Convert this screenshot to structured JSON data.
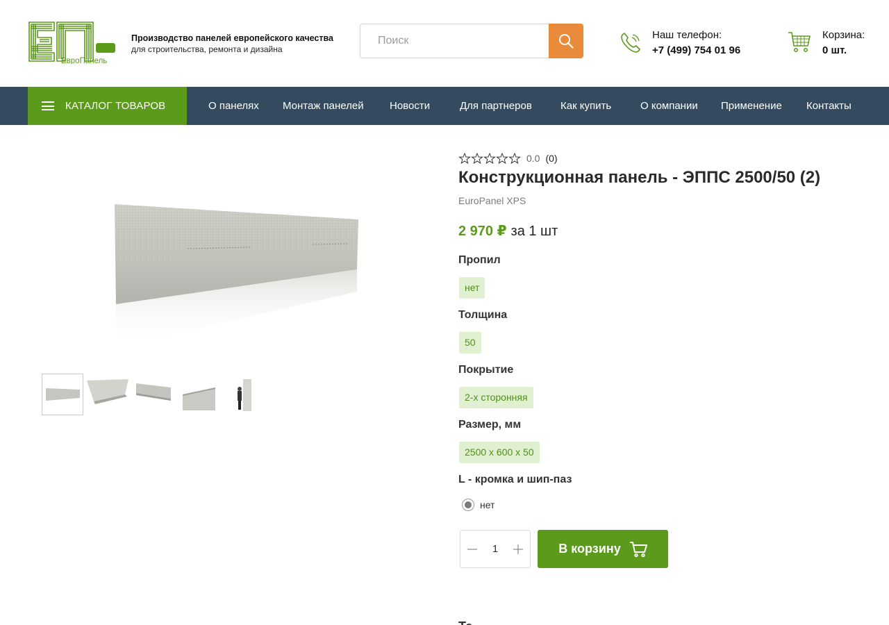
{
  "header": {
    "logo_text": "ЕвроПанель",
    "tagline_line1": "Производство панелей европейского качества",
    "tagline_line2": "для строительства, ремонта и дизайна",
    "search_placeholder": "Поиск",
    "phone_label": "Наш телефон:",
    "phone_number": "+7 (499) 754 01 96",
    "cart_label": "Корзина:",
    "cart_count": "0 шт."
  },
  "nav": {
    "catalog_label": "КАТАЛОГ ТОВАРОВ",
    "items": [
      "О панелях",
      "Монтаж панелей",
      "Новости",
      "Для партнеров",
      "Как купить",
      "О компании",
      "Применение",
      "Контакты"
    ]
  },
  "gallery": {
    "thumbnail_count": 5,
    "active_thumbnail": 1
  },
  "product": {
    "rating_value": "0.0",
    "rating_count": "(0)",
    "stars_filled": 0,
    "stars_total": 5,
    "title": "Конструкционная панель - ЭППС 2500/50 (2)",
    "brand": "EuroPanel XPS",
    "price": "2 970 ₽",
    "price_unit": "за 1 шт",
    "properties": [
      {
        "label": "Пропил",
        "value": "нет"
      },
      {
        "label": "Толщина",
        "value": "50"
      },
      {
        "label": "Покрытие",
        "value": "2-х сторонняя"
      },
      {
        "label": "Размер, мм",
        "value": "2500 х 600 х 50"
      }
    ],
    "edge_label": "L - кромка и шип-паз",
    "edge_option": "нет",
    "quantity": "1",
    "add_to_cart": "В корзину",
    "next_section_heading": "Те"
  },
  "colors": {
    "brand_green": "#5b9a1a",
    "nav_bg": "#344b5f",
    "search_button": "#ea8a3b",
    "chip_bg": "#e2f0d2"
  },
  "icons": {
    "search": "search-icon",
    "phone": "phone-icon",
    "cart": "cart-icon",
    "menu": "hamburger-icon",
    "star": "star-outline-icon"
  }
}
